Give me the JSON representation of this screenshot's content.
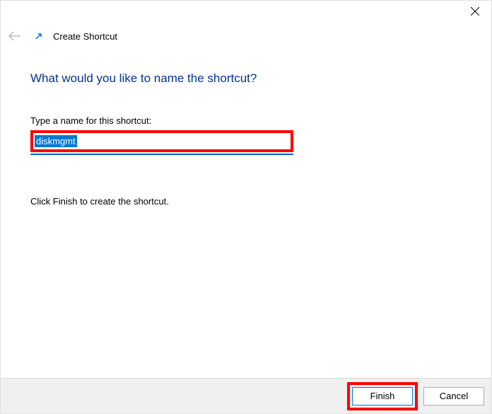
{
  "window": {
    "title": "Create Shortcut"
  },
  "content": {
    "heading": "What would you like to name the shortcut?",
    "field_label": "Type a name for this shortcut:",
    "input_value": "diskmgmt",
    "instruction": "Click Finish to create the shortcut."
  },
  "buttons": {
    "finish": "Finish",
    "cancel": "Cancel"
  }
}
